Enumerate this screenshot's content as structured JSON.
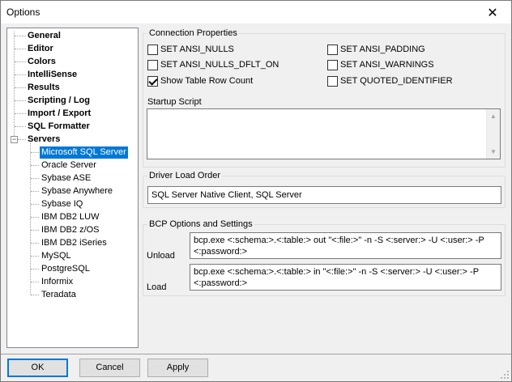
{
  "window": {
    "title": "Options",
    "close_glyph": "✕"
  },
  "tree": {
    "items": [
      {
        "label": "General"
      },
      {
        "label": "Editor"
      },
      {
        "label": "Colors"
      },
      {
        "label": "IntelliSense"
      },
      {
        "label": "Results"
      },
      {
        "label": "Scripting / Log"
      },
      {
        "label": "Import / Export"
      },
      {
        "label": "SQL Formatter"
      },
      {
        "label": "Servers"
      }
    ],
    "servers": [
      {
        "label": "Microsoft SQL Server"
      },
      {
        "label": "Oracle Server"
      },
      {
        "label": "Sybase ASE"
      },
      {
        "label": "Sybase Anywhere"
      },
      {
        "label": "Sybase IQ"
      },
      {
        "label": "IBM DB2 LUW"
      },
      {
        "label": "IBM DB2 z/OS"
      },
      {
        "label": "IBM DB2 iSeries"
      },
      {
        "label": "MySQL"
      },
      {
        "label": "PostgreSQL"
      },
      {
        "label": "Informix"
      },
      {
        "label": "Teradata"
      }
    ],
    "selected": "Microsoft SQL Server",
    "expander_glyph": "−"
  },
  "connection": {
    "title": "Connection Properties",
    "options": [
      {
        "label": "SET ANSI_NULLS",
        "checked": false
      },
      {
        "label": "SET ANSI_NULLS_DFLT_ON",
        "checked": false
      },
      {
        "label": "Show Table Row Count",
        "checked": true
      },
      {
        "label": "SET ANSI_PADDING",
        "checked": false
      },
      {
        "label": "SET ANSI_WARNINGS",
        "checked": false
      },
      {
        "label": "SET QUOTED_IDENTIFIER",
        "checked": false
      }
    ]
  },
  "startup_script": {
    "label": "Startup Script",
    "value": ""
  },
  "driver": {
    "title": "Driver Load Order",
    "value": "SQL Server Native Client, SQL Server"
  },
  "bcp": {
    "title": "BCP Options and Settings",
    "unload_label": "Unload",
    "unload_value": "bcp.exe <:schema:>.<:table:> out \"<:file:>\" -n -S <:server:> -U <:user:> -P <:password:>",
    "load_label": "Load",
    "load_value": "bcp.exe <:schema:>.<:table:> in \"<:file:>\" -n -S <:server:> -U <:user:> -P <:password:>"
  },
  "buttons": {
    "ok": "OK",
    "cancel": "Cancel",
    "apply": "Apply"
  },
  "icons": {
    "scroll_up": "▲",
    "scroll_down": "▼"
  },
  "colors": {
    "selection": "#0078d7",
    "window_bg": "#f0f0f0"
  }
}
